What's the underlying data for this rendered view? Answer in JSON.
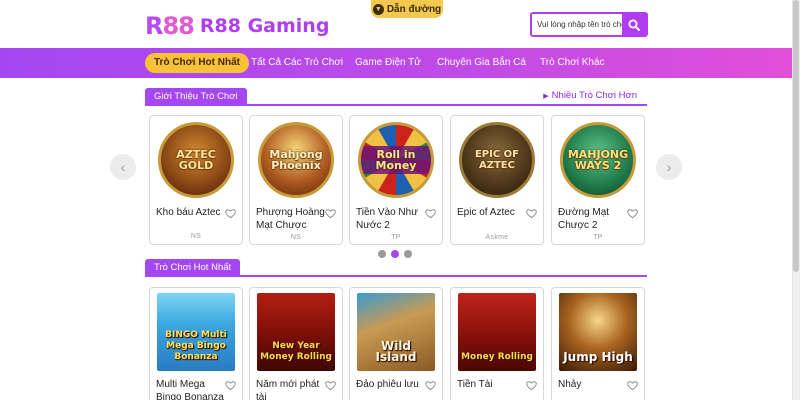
{
  "header": {
    "logo_mark": "R88",
    "logo_text": "R88 Gaming",
    "guide_label": "Dẫn đường",
    "search_placeholder": "Vui lòng nhập tên trò chơi."
  },
  "nav": {
    "items": [
      {
        "label": "Trò Chơi Hot Nhất",
        "active": true
      },
      {
        "label": "Tất Cả Các Trò Chơi"
      },
      {
        "label": "Game Điện Tử"
      },
      {
        "label": "Chuyên Gia Bắn Cá"
      },
      {
        "label": "Trò Chơi Khác"
      }
    ]
  },
  "intro": {
    "title": "Giới Thiệu Trò Chơi",
    "more": "Nhiều Trò Chơi Hơn",
    "cards": [
      {
        "thumb": "AZTEC GOLD",
        "name": "Kho báu Aztec",
        "provider": "NS"
      },
      {
        "thumb": "Mahjong Phoenix",
        "name": "Phượng Hoàng Mạt Chược",
        "provider": "NS"
      },
      {
        "thumb": "Roll in Money",
        "name": "Tiền Vào Như Nước 2",
        "provider": "TP"
      },
      {
        "thumb": "EPIC OF AZTEC",
        "name": "Epic of Aztec",
        "provider": "Askme"
      },
      {
        "thumb": "MAHJONG WAYS 2",
        "name": "Đường Mạt Chược 2",
        "provider": "TP"
      }
    ],
    "page_count": 3,
    "active_page": 2
  },
  "hot": {
    "title": "Trò Chơi Hot Nhất",
    "cards": [
      {
        "thumb": "BINGO Multi Mega Bingo Bonanza",
        "name": "Multi Mega Bingo Bonanza"
      },
      {
        "thumb": "New Year Money Rolling",
        "name": "Năm mới phát tài"
      },
      {
        "thumb": "Wild Island",
        "name": "Đảo phiêu lưu"
      },
      {
        "thumb": "Money Rolling",
        "name": "Tiền Tài"
      },
      {
        "thumb": "Jump High",
        "name": "Nhảy"
      }
    ]
  },
  "colors": {
    "brand_purple": "#a447f2",
    "nav_end_pink": "#e24fd8",
    "active_yellow": "#f6c338"
  },
  "icons": {
    "search": "search-icon",
    "heart": "heart-icon",
    "prev": "chevron-left-icon",
    "next": "chevron-right-icon",
    "guide": "chevron-down-icon",
    "more": "triangle-right-icon"
  }
}
